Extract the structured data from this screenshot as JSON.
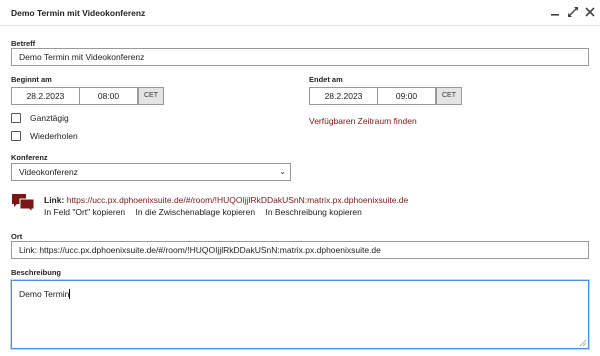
{
  "window": {
    "title": "Demo Termin mit Videokonferenz"
  },
  "betreff": {
    "label": "Betreff",
    "value": "Demo Termin mit Videokonferenz"
  },
  "start": {
    "label": "Beginnt am",
    "date": "28.2.2023",
    "time": "08:00",
    "tz": "CET"
  },
  "end": {
    "label": "Endet am",
    "date": "28.2.2023",
    "time": "09:00",
    "tz": "CET"
  },
  "options": {
    "allday_label": "Ganztägig",
    "repeat_label": "Wiederholen",
    "find_slot": "Verfügbaren Zeitraum finden"
  },
  "konferenz": {
    "label": "Konferenz",
    "selected": "Videokonferenz"
  },
  "link": {
    "label": "Link:",
    "url": "https://ucc.px.dphoenixsuite.de/#/room/!HUQOIjjlRkDDakUSnN:matrix.px.dphoenixsuite.de",
    "copy_location": "In Feld \"Ort\" kopieren",
    "copy_clipboard": "In die Zwischenablage kopieren",
    "copy_description": "In Beschreibung kopieren"
  },
  "ort": {
    "label": "Ort",
    "value": "Link: https://ucc.px.dphoenixsuite.de/#/room/!HUQOIjjlRkDDakUSnN:matrix.px.dphoenixsuite.de"
  },
  "beschreibung": {
    "label": "Beschreibung",
    "value": "Demo Termin"
  },
  "icons": {
    "minimize": "minimize-icon",
    "maximize": "expand-icon",
    "close": "close-icon",
    "chat": "chat-bubbles-icon"
  },
  "colors": {
    "accent_red": "#7a1818",
    "focus_blue": "#4a90e2"
  }
}
